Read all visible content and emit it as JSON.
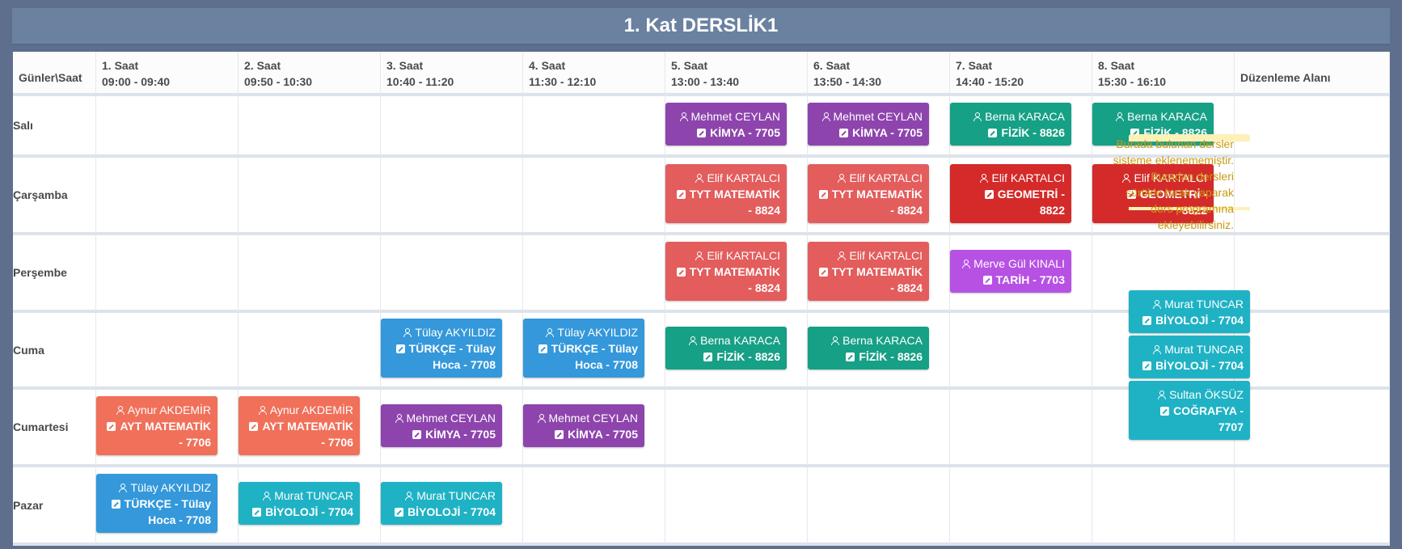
{
  "title": "1. Kat DERSLİK1",
  "header": {
    "corner": "Günler\\Saat",
    "slots": [
      {
        "label": "1. Saat",
        "time": "09:00 - 09:40"
      },
      {
        "label": "2. Saat",
        "time": "09:50 - 10:30"
      },
      {
        "label": "3. Saat",
        "time": "10:40 - 11:20"
      },
      {
        "label": "4. Saat",
        "time": "11:30 - 12:10"
      },
      {
        "label": "5. Saat",
        "time": "13:00 - 13:40"
      },
      {
        "label": "6. Saat",
        "time": "13:50 - 14:30"
      },
      {
        "label": "7. Saat",
        "time": "14:40 - 15:20"
      },
      {
        "label": "8. Saat",
        "time": "15:30 - 16:10"
      }
    ],
    "edit_area": "Düzenleme Alanı"
  },
  "days": [
    "Salı",
    "Çarşamba",
    "Perşembe",
    "Cuma",
    "Cumartesi",
    "Pazar"
  ],
  "lessons": {
    "sali_5": {
      "teacher": "Mehmet CEYLAN",
      "lesson": "KİMYA - 7705"
    },
    "sali_6": {
      "teacher": "Mehmet CEYLAN",
      "lesson": "KİMYA - 7705"
    },
    "sali_7": {
      "teacher": "Berna KARACA",
      "lesson": "FİZİK - 8826"
    },
    "sali_8": {
      "teacher": "Berna KARACA",
      "lesson": "FİZİK - 8826"
    },
    "carsamba_5": {
      "teacher": "Elif KARTALCI",
      "lesson": "TYT MATEMATİK - 8824"
    },
    "carsamba_6": {
      "teacher": "Elif KARTALCI",
      "lesson": "TYT MATEMATİK - 8824"
    },
    "carsamba_7": {
      "teacher": "Elif KARTALCI",
      "lesson": "GEOMETRİ - 8822"
    },
    "carsamba_8": {
      "teacher": "Elif KARTALCI",
      "lesson": "GEOMETRİ - 8822"
    },
    "persembe_5": {
      "teacher": "Elif KARTALCI",
      "lesson": "TYT MATEMATİK - 8824"
    },
    "persembe_6": {
      "teacher": "Elif KARTALCI",
      "lesson": "TYT MATEMATİK - 8824"
    },
    "persembe_7": {
      "teacher": "Merve Gül KINALI",
      "lesson": "TARİH - 7703"
    },
    "cuma_3": {
      "teacher": "Tülay AKYILDIZ",
      "lesson": "TÜRKÇE - Tülay Hoca - 7708"
    },
    "cuma_4": {
      "teacher": "Tülay AKYILDIZ",
      "lesson": "TÜRKÇE - Tülay Hoca - 7708"
    },
    "cuma_5": {
      "teacher": "Berna KARACA",
      "lesson": "FİZİK - 8826"
    },
    "cuma_6": {
      "teacher": "Berna KARACA",
      "lesson": "FİZİK - 8826"
    },
    "cumartesi_1": {
      "teacher": "Aynur AKDEMİR",
      "lesson": "AYT MATEMATİK - 7706"
    },
    "cumartesi_2": {
      "teacher": "Aynur AKDEMİR",
      "lesson": "AYT MATEMATİK - 7706"
    },
    "cumartesi_3": {
      "teacher": "Mehmet CEYLAN",
      "lesson": "KİMYA - 7705"
    },
    "cumartesi_4": {
      "teacher": "Mehmet CEYLAN",
      "lesson": "KİMYA - 7705"
    },
    "pazar_1": {
      "teacher": "Tülay AKYILDIZ",
      "lesson": "TÜRKÇE - Tülay Hoca - 7708"
    },
    "pazar_2": {
      "teacher": "Murat TUNCAR",
      "lesson": "BİYOLOJİ - 7704"
    },
    "pazar_3": {
      "teacher": "Murat TUNCAR",
      "lesson": "BİYOLOJİ - 7704"
    }
  },
  "edit_note": "Burada bulunan dersler sisteme eklenememiştir. Buradan dersleri sürükle bırak yaparak ders programına ekleyebilirsiniz.",
  "pool": [
    {
      "teacher": "Murat TUNCAR",
      "lesson": "BİYOLOJİ - 7704"
    },
    {
      "teacher": "Murat TUNCAR",
      "lesson": "BİYOLOJİ - 7704"
    },
    {
      "teacher": "Sultan ÖKSÜZ",
      "lesson": "COĞRAFYA - 7707"
    }
  ],
  "colors": {
    "purple": "#8e44ad",
    "teal": "#16a085",
    "salmon": "#e35d5d",
    "red": "#d42a2a",
    "violet": "#b751e4",
    "blue": "#3498db",
    "orange": "#f0705a",
    "cyan": "#1fb2c4"
  }
}
